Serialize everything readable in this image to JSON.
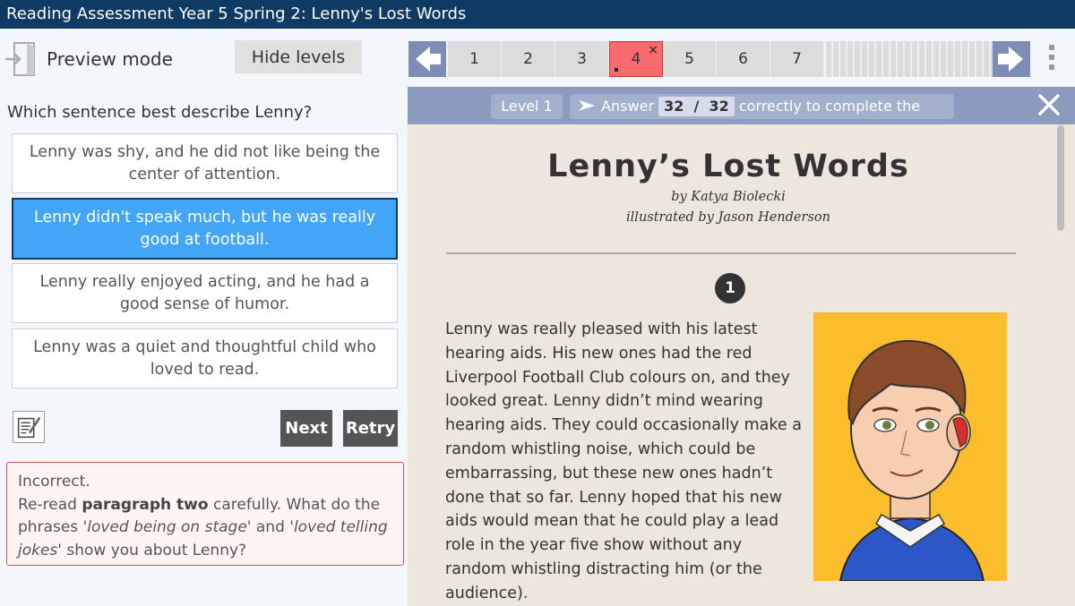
{
  "window": {
    "title": "Reading Assessment Year 5 Spring 2: Lenny's Lost Words"
  },
  "left": {
    "preview_label": "Preview mode",
    "hide_levels_label": "Hide levels",
    "question": "Which sentence best describe Lenny?",
    "options": [
      {
        "text": "Lenny was shy, and he did not like being the center of attention.",
        "selected": false
      },
      {
        "text": "Lenny didn't speak much, but he was really good at football.",
        "selected": true
      },
      {
        "text": "Lenny really enjoyed acting, and he had a good sense of humor.",
        "selected": false
      },
      {
        "text": "Lenny was a quiet and thoughtful child who loved to read.",
        "selected": false
      }
    ],
    "next_label": "Next",
    "retry_label": "Retry",
    "feedback": {
      "heading": "Incorrect.",
      "part1": "Re-read ",
      "bold": "paragraph two",
      "part2": " carefully. What do the phrases ",
      "italic1": "'loved being on stage'",
      "part3": " and ",
      "italic2": "'loved telling jokes'",
      "part4": " show you about Lenny?"
    }
  },
  "nav": {
    "pages": [
      "1",
      "2",
      "3",
      "4",
      "5",
      "6",
      "7"
    ],
    "active_page": "4",
    "active_page_mark": "×"
  },
  "level": {
    "level_label": "Level 1",
    "answer_prefix": "Answer",
    "correct": "32",
    "separator": "/",
    "total": "32",
    "answer_suffix": "correctly to complete the level"
  },
  "story": {
    "title": "Lenny’s Lost Words",
    "author": "by Katya Biolecki",
    "illustrator": "illustrated by Jason Henderson",
    "paragraph_number": "1",
    "paragraph": "Lenny was really pleased with his latest hearing aids. His new ones had the red Liverpool Football Club colours on, and they looked great. Lenny didn’t mind wearing hearing aids. They could occasionally make a random whistling noise, which could be embarrassing, but these new ones hadn’t done that so far.  Lenny hoped that his new aids would mean that he could play a lead role in the year five show without any random whistling distracting him (or the audience)."
  },
  "colors": {
    "title_bar": "#0f3a63",
    "selected_option": "#42a5f5",
    "active_page": "#f86a6e",
    "level_bar": "#8c9bbd",
    "illustration_bg": "#fbbd2c"
  },
  "icons": [
    "exit-door-icon",
    "arrow-left-icon",
    "arrow-right-icon",
    "more-vertical-icon",
    "close-icon",
    "notes-icon",
    "play-arrow-icon"
  ]
}
